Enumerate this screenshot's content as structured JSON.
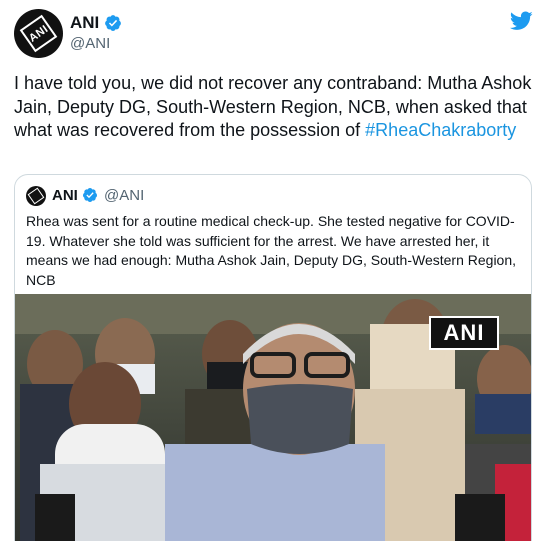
{
  "author": {
    "name": "ANI",
    "handle": "@ANI"
  },
  "tweet": {
    "text": "I have told you, we did not recover any contraband: Mutha Ashok Jain, Deputy DG, South-Western Region, NCB, when asked that what was recovered from the possession of ",
    "hashtag": "#RheaChakraborty"
  },
  "quoted": {
    "name": "ANI",
    "handle": "@ANI",
    "text": "Rhea was sent for a routine medical check-up. She tested negative for COVID-19. Whatever she told was sufficient for the arrest. We have arrested her, it means we had enough: Mutha Ashok Jain, Deputy DG, South-Western Region, NCB",
    "media_watermark": "ANI"
  },
  "icons": {
    "verified": "verified-badge-icon",
    "platform": "twitter-bird-icon"
  },
  "colors": {
    "link": "#1b95e0",
    "verified": "#1d9bf0",
    "secondary_text": "#536471"
  }
}
